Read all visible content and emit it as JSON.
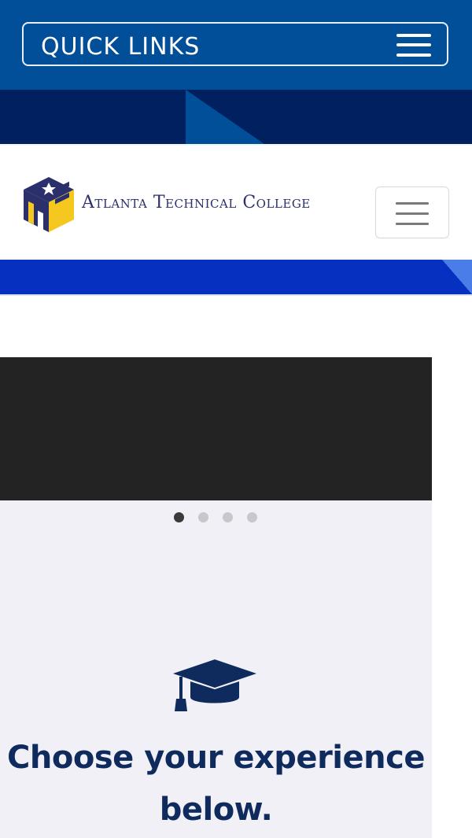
{
  "topbar": {
    "quick_links_label": "QUICK LINKS",
    "menu_icon": "hamburger-icon"
  },
  "header": {
    "logo_icon": "atlanta-technical-college-logo",
    "logo_text": "Atlanta Technical College",
    "nav_toggle_icon": "hamburger-icon"
  },
  "slider": {
    "slide_count": 4,
    "active_index": 0
  },
  "experience": {
    "icon": "graduation-cap-icon",
    "heading": "Choose your experience below."
  },
  "colors": {
    "topbar": "#004f98",
    "dark_band": "#002060",
    "blue_band": "#0530c0",
    "heading": "#0f2a5c",
    "logo_yellow": "#f4c81e",
    "panel_bg": "#f1f0f7"
  }
}
